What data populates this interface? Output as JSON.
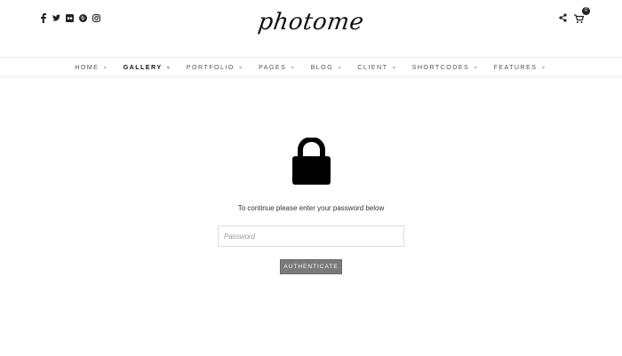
{
  "header": {
    "logo_text": "photome",
    "social_icons": [
      "facebook-icon",
      "twitter-icon",
      "flickr-icon",
      "pinterest-icon",
      "instagram-icon"
    ],
    "cart_count": "0"
  },
  "nav": {
    "items": [
      {
        "label": "HOME"
      },
      {
        "label": "GALLERY"
      },
      {
        "label": "PORTFOLIO"
      },
      {
        "label": "PAGES"
      },
      {
        "label": "BLOG"
      },
      {
        "label": "CLIENT"
      },
      {
        "label": "SHORTCODES"
      },
      {
        "label": "FEATURES"
      }
    ],
    "active": "GALLERY"
  },
  "protect": {
    "icon": "lock-icon",
    "prompt": "To continue please enter your password below",
    "password_placeholder": "Password",
    "password_value": "",
    "button_label": "AUTHENTICATE"
  },
  "colors": {
    "button_bg": "#7a7a7a",
    "text": "#222222"
  }
}
